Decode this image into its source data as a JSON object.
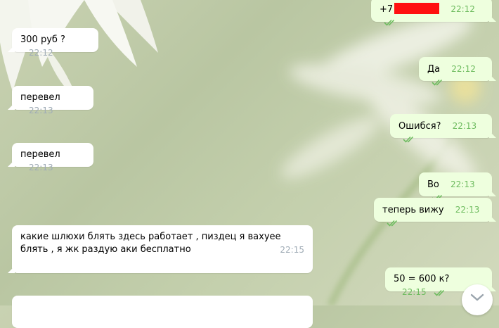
{
  "colors": {
    "incoming_bubble": "#ffffff",
    "outgoing_bubble": "#eeffde",
    "time_in": "#a0acb6",
    "time_out": "#6dbb5e",
    "redaction": "#ff1010"
  },
  "messages": [
    {
      "id": "m1",
      "dir": "out",
      "prefix": "+7",
      "redacted": true,
      "time": "22:12",
      "read": true
    },
    {
      "id": "m2",
      "dir": "in",
      "text": "300 руб ?",
      "time": "22:12"
    },
    {
      "id": "m3",
      "dir": "out",
      "text": "Да",
      "time": "22:12",
      "read": true
    },
    {
      "id": "m4",
      "dir": "in",
      "text": "перевел",
      "time": "22:13"
    },
    {
      "id": "m5",
      "dir": "out",
      "text": "Ошибся?",
      "time": "22:13",
      "read": true
    },
    {
      "id": "m6",
      "dir": "in",
      "text": "перевел",
      "time": "22:13"
    },
    {
      "id": "m7",
      "dir": "out",
      "text": "Во",
      "time": "22:13",
      "read": true
    },
    {
      "id": "m8",
      "dir": "out",
      "text": "теперь вижу",
      "time": "22:13",
      "read": true
    },
    {
      "id": "m9",
      "dir": "in",
      "text": "какие шлюхи блять здесь работает , пиздец я вахуее блять , я жк раздую аки бесплатно",
      "time": "22:15"
    },
    {
      "id": "m10",
      "dir": "out",
      "text": "50 = 600 к?",
      "time": "22:15",
      "read": true
    }
  ],
  "icons": {
    "read_receipt": "double-check-icon",
    "scroll_down": "chevron-down-icon"
  }
}
